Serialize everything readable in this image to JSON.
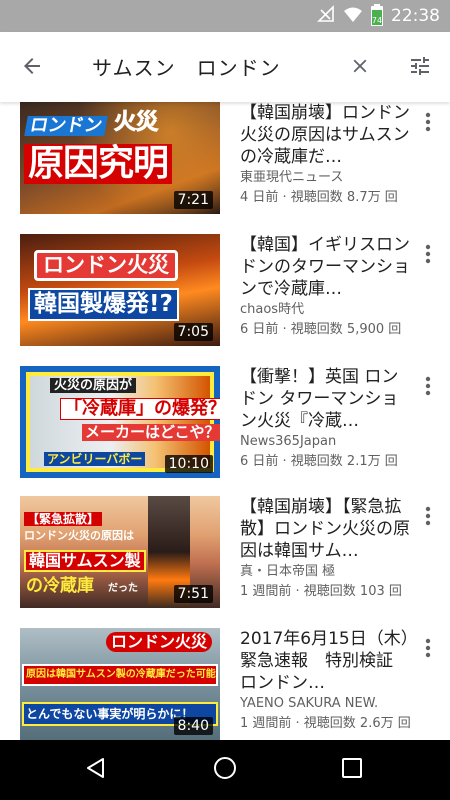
{
  "status_bar": {
    "time": "22:38",
    "battery_level": "74"
  },
  "search": {
    "query": "サムスン　ロンドン"
  },
  "results": [
    {
      "title": "【韓国崩壊】ロンドン火災の原因はサムスンの冷蔵庫だ…",
      "channel": "東亜現代ニュース",
      "stats": "4 日前 · 視聴回数 8.7万 回",
      "duration": "7:21",
      "thumb_text": [
        "ロンドン",
        "火災",
        "原因究明"
      ]
    },
    {
      "title": "【韓国】イギリスロンドンのタワーマンションで冷蔵庫…",
      "channel": "chaos時代",
      "stats": "6 日前 · 視聴回数 5,900 回",
      "duration": "7:05",
      "thumb_text": [
        "ロンドン火災",
        "韓国製爆発!?"
      ]
    },
    {
      "title": "【衝撃！】英国 ロンドン タワーマンション火災『冷蔵…",
      "channel": "News365Japan",
      "stats": "6 日前 · 視聴回数 2.1万 回",
      "duration": "10:10",
      "thumb_text": [
        "火災の原因が",
        "「冷蔵庫」の爆発？",
        "メーカーはどこや？",
        "アンビリーバボー"
      ]
    },
    {
      "title": "【韓国崩壊】【緊急拡散】ロンドン火災の原因は韓国サム…",
      "channel": "真・日本帝国 極",
      "stats": "1 週間前 · 視聴回数 103 回",
      "duration": "7:51",
      "thumb_text": [
        "【緊急拡散】",
        "ロンドン火災の原因は",
        "韓国サムスン製",
        "の冷蔵庫",
        "だった"
      ]
    },
    {
      "title": "2017年6月15日（木）緊急速報　特別検証　ロンドン…",
      "channel": "YAENO SAKURA NEW.",
      "stats": "1 週間前 · 視聴回数 2.6万 回",
      "duration": "8:40",
      "thumb_text": [
        "ロンドン火災",
        "原因は韓国サムスン製の冷蔵庫だった可能性浮上",
        "とんでもない事実が明らかに！"
      ]
    }
  ],
  "colors": {
    "status_bar": "#a8a8a8",
    "nav_bar": "#000000",
    "accent_red": "#d50000"
  }
}
